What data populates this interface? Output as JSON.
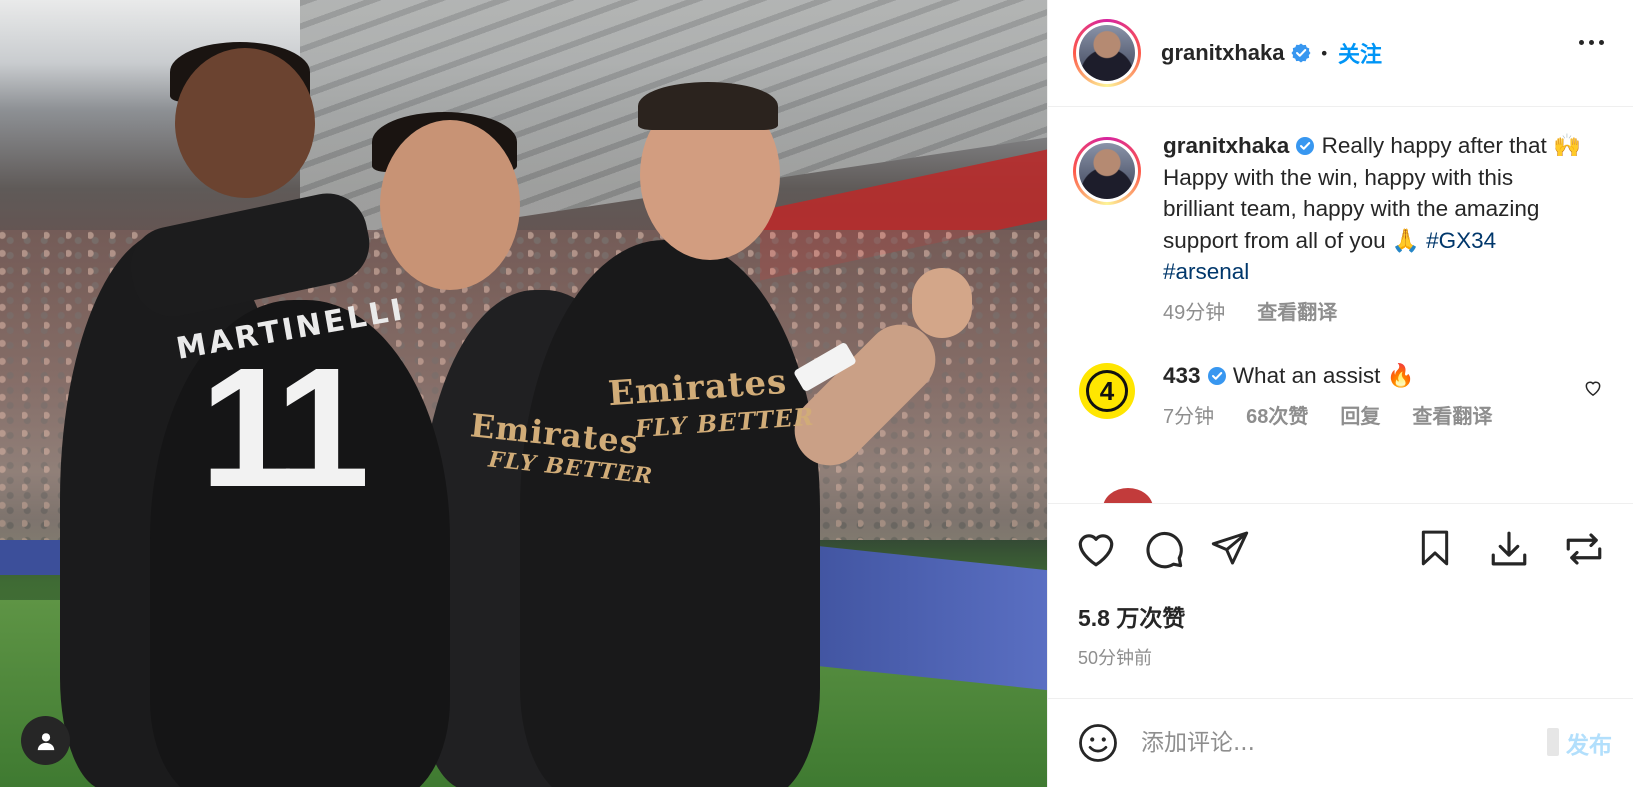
{
  "post": {
    "image_alt": "",
    "jersey_name": "MARTINELLI",
    "jersey_number": "11",
    "sponsor_line1": "Emirates",
    "sponsor_line2": "FLY BETTER"
  },
  "header": {
    "username": "granitxhaka",
    "verified_icon": "verified-badge-icon",
    "separator": "•",
    "follow_label": "关注",
    "more_icon": "more-options-icon"
  },
  "caption": {
    "username": "granitxhaka",
    "text_1": "Really happy after that ",
    "emoji_1": "🙌",
    "text_2": " Happy with the win, happy with this brilliant team, happy with the amazing support from all of you ",
    "emoji_2": "🙏",
    "hashtag_1": "#GX34",
    "hashtag_2": "#arsenal",
    "time": "49分钟",
    "translate_label": "查看翻译"
  },
  "comments": [
    {
      "username": "433",
      "avatar_text": "4",
      "text": "What an assist ",
      "emoji": "🔥",
      "time": "7分钟",
      "likes": "68次赞",
      "reply_label": "回复",
      "translate_label": "查看翻译"
    }
  ],
  "actions": {
    "like_icon": "heart-icon",
    "comment_icon": "comment-icon",
    "share_icon": "paper-plane-icon",
    "save_icon": "bookmark-icon",
    "download_icon": "download-icon",
    "repost_icon": "repost-icon",
    "likes_count": "5.8 万次赞",
    "posted_ago": "50分钟前"
  },
  "comment_box": {
    "placeholder": "添加评论...",
    "value": "",
    "post_label": "发布",
    "emoji_icon": "smiley-icon"
  },
  "colors": {
    "accent_blue": "#0095f6",
    "verified_blue": "#3897f0",
    "hashtag": "#00376b",
    "muted_text": "#8e8e8e",
    "post_disabled": "#b2dffc"
  }
}
